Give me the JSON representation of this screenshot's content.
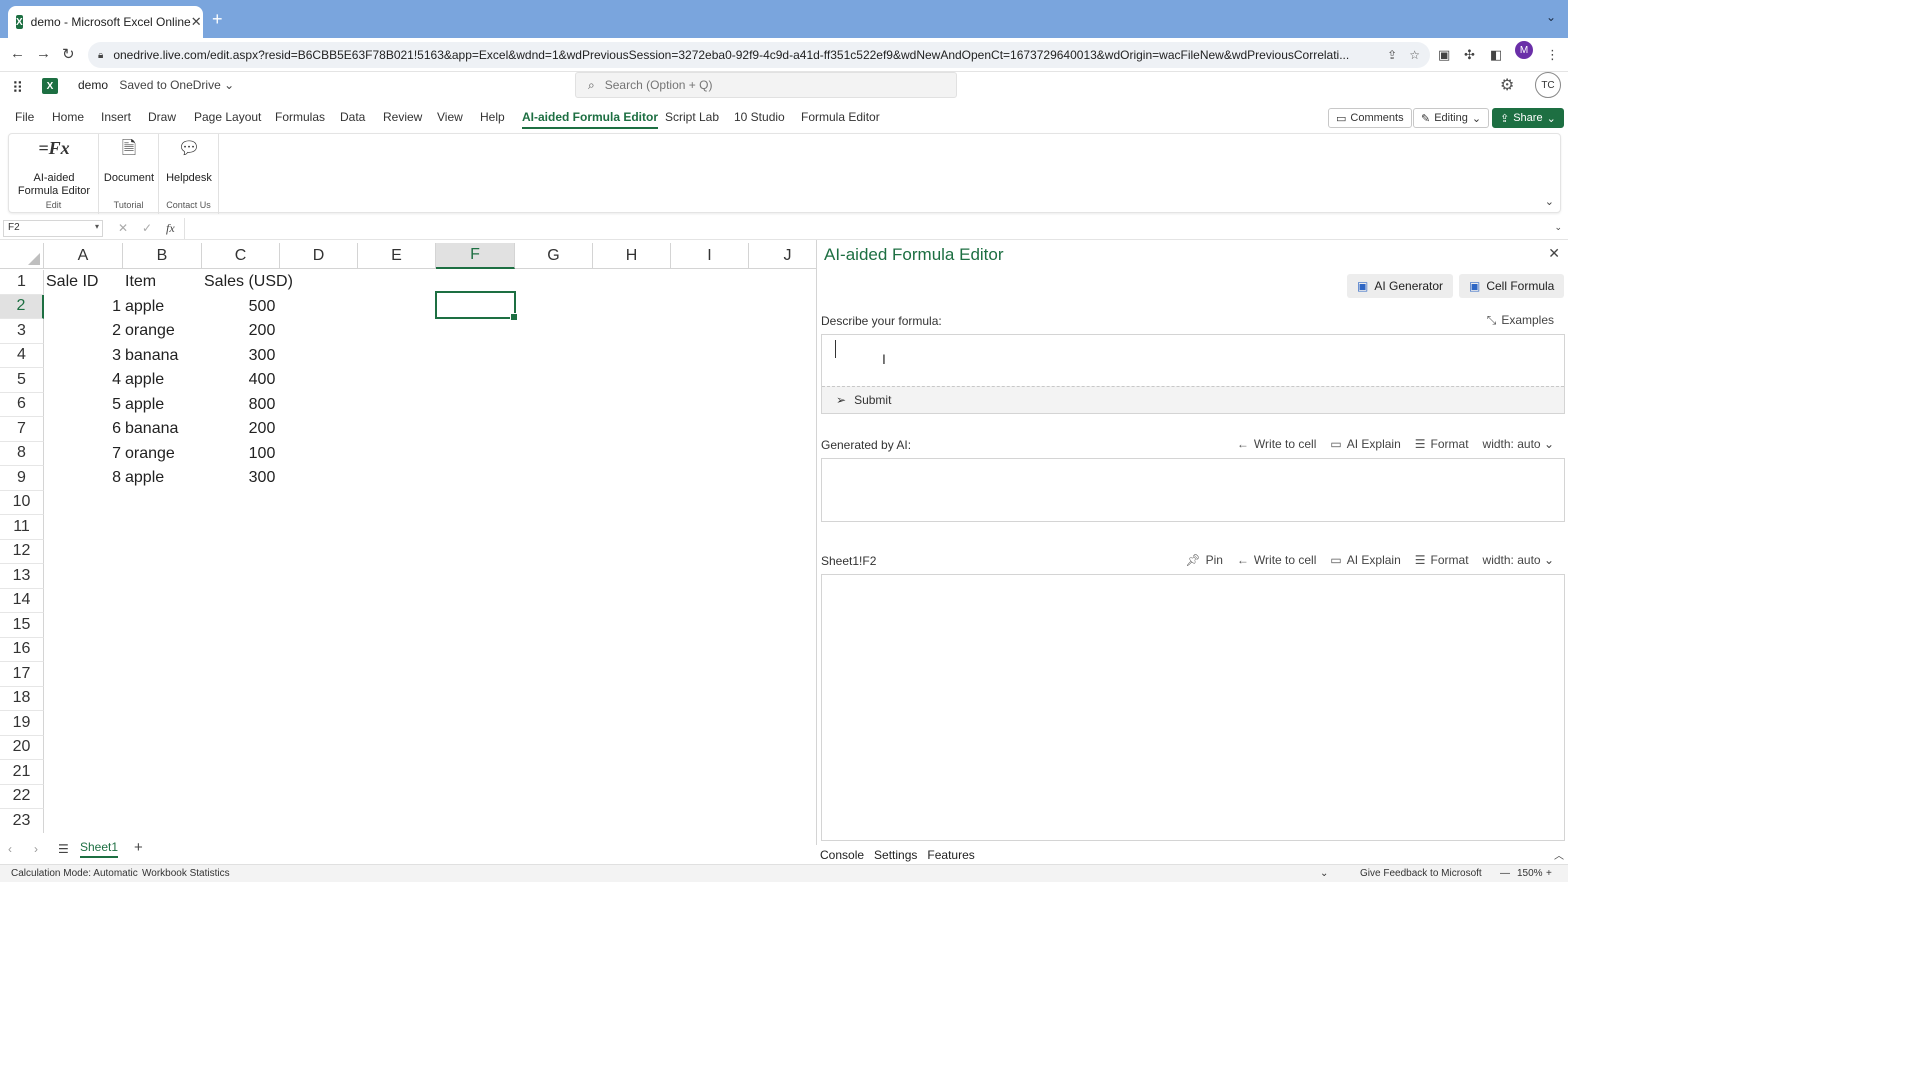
{
  "browser": {
    "tab_title": "demo - Microsoft Excel Online",
    "url": "onedrive.live.com/edit.aspx?resid=B6CBB5E63F78B021!5163&app=Excel&wdnd=1&wdPreviousSession=3272eba0-92f9-4c9d-a41d-ff351c522ef9&wdNewAndOpenCt=1673729640013&wdOrigin=wacFileNew&wdPreviousCorrelati...",
    "profile_initial": "M"
  },
  "excel": {
    "doc_name": "demo",
    "save_status": "Saved to OneDrive",
    "search_placeholder": "Search (Option + Q)",
    "user_initials": "TC",
    "ribbon_tabs": [
      "File",
      "Home",
      "Insert",
      "Draw",
      "Page Layout",
      "Formulas",
      "Data",
      "Review",
      "View",
      "Help",
      "AI-aided Formula Editor",
      "Script Lab",
      "10 Studio",
      "Formula Editor"
    ],
    "active_tab": "AI-aided Formula Editor",
    "comments_label": "Comments",
    "editing_label": "Editing",
    "share_label": "Share",
    "ribbon_groups": [
      {
        "command": "AI-aided Formula Editor",
        "group": "Edit"
      },
      {
        "command": "Document",
        "group": "Tutorial"
      },
      {
        "command": "Helpdesk",
        "group": "Contact Us"
      }
    ],
    "name_box": "F2",
    "fx_label": "fx"
  },
  "grid": {
    "columns": [
      "A",
      "B",
      "C",
      "D",
      "E",
      "F",
      "G",
      "H",
      "I",
      "J"
    ],
    "selected_column": "F",
    "rows": [
      "1",
      "2",
      "3",
      "4",
      "5",
      "6",
      "7",
      "8",
      "9",
      "10",
      "11",
      "12",
      "13",
      "14",
      "15",
      "16",
      "17",
      "18",
      "19",
      "20",
      "21",
      "22",
      "23"
    ],
    "selected_row": "2",
    "headers": [
      "Sale ID",
      "Item",
      "Sales (USD)"
    ],
    "data": [
      [
        "1",
        "apple",
        "500"
      ],
      [
        "2",
        "orange",
        "200"
      ],
      [
        "3",
        "banana",
        "300"
      ],
      [
        "4",
        "apple",
        "400"
      ],
      [
        "5",
        "apple",
        "800"
      ],
      [
        "6",
        "banana",
        "200"
      ],
      [
        "7",
        "orange",
        "100"
      ],
      [
        "8",
        "apple",
        "300"
      ]
    ]
  },
  "pane": {
    "title": "AI-aided Formula Editor",
    "ai_generator_label": "AI Generator",
    "cell_formula_label": "Cell Formula",
    "describe_label": "Describe your formula:",
    "examples_label": "Examples",
    "describe_value": "",
    "submit_label": "Submit",
    "generated_label": "Generated by AI:",
    "write_to_cell_label": "Write to cell",
    "ai_explain_label": "AI Explain",
    "format_label": "Format",
    "width_label": "width: auto",
    "cell_ref_label": "Sheet1!F2",
    "pin_label": "Pin",
    "bottom_tabs": [
      "Console",
      "Settings",
      "Features"
    ]
  },
  "sheets": {
    "active_sheet": "Sheet1"
  },
  "status": {
    "calc_mode": "Calculation Mode: Automatic",
    "workbook_stats": "Workbook Statistics",
    "feedback": "Give Feedback to Microsoft",
    "zoom": "150%"
  },
  "colors": {
    "excel_green": "#1d6f42",
    "tabbar_blue": "#7aa5dd",
    "accent_blue": "#2e66c4"
  }
}
